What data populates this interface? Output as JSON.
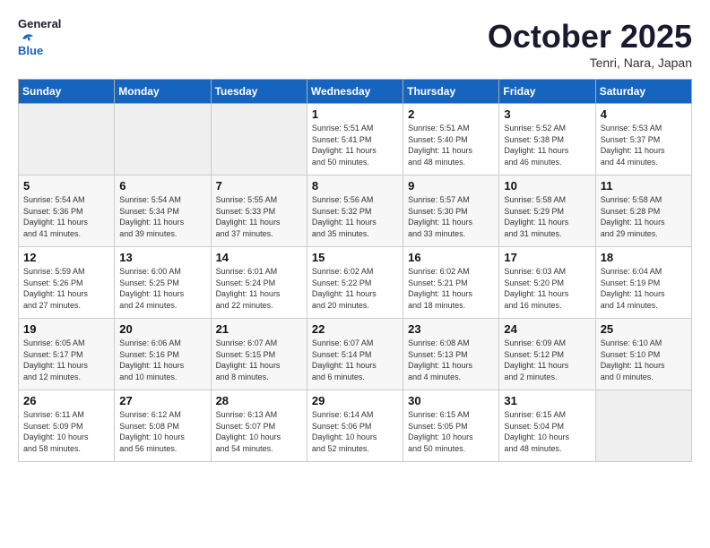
{
  "logo": {
    "line1": "General",
    "line2": "Blue"
  },
  "title": "October 2025",
  "location": "Tenri, Nara, Japan",
  "weekdays": [
    "Sunday",
    "Monday",
    "Tuesday",
    "Wednesday",
    "Thursday",
    "Friday",
    "Saturday"
  ],
  "weeks": [
    [
      {
        "day": "",
        "info": ""
      },
      {
        "day": "",
        "info": ""
      },
      {
        "day": "",
        "info": ""
      },
      {
        "day": "1",
        "info": "Sunrise: 5:51 AM\nSunset: 5:41 PM\nDaylight: 11 hours\nand 50 minutes."
      },
      {
        "day": "2",
        "info": "Sunrise: 5:51 AM\nSunset: 5:40 PM\nDaylight: 11 hours\nand 48 minutes."
      },
      {
        "day": "3",
        "info": "Sunrise: 5:52 AM\nSunset: 5:38 PM\nDaylight: 11 hours\nand 46 minutes."
      },
      {
        "day": "4",
        "info": "Sunrise: 5:53 AM\nSunset: 5:37 PM\nDaylight: 11 hours\nand 44 minutes."
      }
    ],
    [
      {
        "day": "5",
        "info": "Sunrise: 5:54 AM\nSunset: 5:36 PM\nDaylight: 11 hours\nand 41 minutes."
      },
      {
        "day": "6",
        "info": "Sunrise: 5:54 AM\nSunset: 5:34 PM\nDaylight: 11 hours\nand 39 minutes."
      },
      {
        "day": "7",
        "info": "Sunrise: 5:55 AM\nSunset: 5:33 PM\nDaylight: 11 hours\nand 37 minutes."
      },
      {
        "day": "8",
        "info": "Sunrise: 5:56 AM\nSunset: 5:32 PM\nDaylight: 11 hours\nand 35 minutes."
      },
      {
        "day": "9",
        "info": "Sunrise: 5:57 AM\nSunset: 5:30 PM\nDaylight: 11 hours\nand 33 minutes."
      },
      {
        "day": "10",
        "info": "Sunrise: 5:58 AM\nSunset: 5:29 PM\nDaylight: 11 hours\nand 31 minutes."
      },
      {
        "day": "11",
        "info": "Sunrise: 5:58 AM\nSunset: 5:28 PM\nDaylight: 11 hours\nand 29 minutes."
      }
    ],
    [
      {
        "day": "12",
        "info": "Sunrise: 5:59 AM\nSunset: 5:26 PM\nDaylight: 11 hours\nand 27 minutes."
      },
      {
        "day": "13",
        "info": "Sunrise: 6:00 AM\nSunset: 5:25 PM\nDaylight: 11 hours\nand 24 minutes."
      },
      {
        "day": "14",
        "info": "Sunrise: 6:01 AM\nSunset: 5:24 PM\nDaylight: 11 hours\nand 22 minutes."
      },
      {
        "day": "15",
        "info": "Sunrise: 6:02 AM\nSunset: 5:22 PM\nDaylight: 11 hours\nand 20 minutes."
      },
      {
        "day": "16",
        "info": "Sunrise: 6:02 AM\nSunset: 5:21 PM\nDaylight: 11 hours\nand 18 minutes."
      },
      {
        "day": "17",
        "info": "Sunrise: 6:03 AM\nSunset: 5:20 PM\nDaylight: 11 hours\nand 16 minutes."
      },
      {
        "day": "18",
        "info": "Sunrise: 6:04 AM\nSunset: 5:19 PM\nDaylight: 11 hours\nand 14 minutes."
      }
    ],
    [
      {
        "day": "19",
        "info": "Sunrise: 6:05 AM\nSunset: 5:17 PM\nDaylight: 11 hours\nand 12 minutes."
      },
      {
        "day": "20",
        "info": "Sunrise: 6:06 AM\nSunset: 5:16 PM\nDaylight: 11 hours\nand 10 minutes."
      },
      {
        "day": "21",
        "info": "Sunrise: 6:07 AM\nSunset: 5:15 PM\nDaylight: 11 hours\nand 8 minutes."
      },
      {
        "day": "22",
        "info": "Sunrise: 6:07 AM\nSunset: 5:14 PM\nDaylight: 11 hours\nand 6 minutes."
      },
      {
        "day": "23",
        "info": "Sunrise: 6:08 AM\nSunset: 5:13 PM\nDaylight: 11 hours\nand 4 minutes."
      },
      {
        "day": "24",
        "info": "Sunrise: 6:09 AM\nSunset: 5:12 PM\nDaylight: 11 hours\nand 2 minutes."
      },
      {
        "day": "25",
        "info": "Sunrise: 6:10 AM\nSunset: 5:10 PM\nDaylight: 11 hours\nand 0 minutes."
      }
    ],
    [
      {
        "day": "26",
        "info": "Sunrise: 6:11 AM\nSunset: 5:09 PM\nDaylight: 10 hours\nand 58 minutes."
      },
      {
        "day": "27",
        "info": "Sunrise: 6:12 AM\nSunset: 5:08 PM\nDaylight: 10 hours\nand 56 minutes."
      },
      {
        "day": "28",
        "info": "Sunrise: 6:13 AM\nSunset: 5:07 PM\nDaylight: 10 hours\nand 54 minutes."
      },
      {
        "day": "29",
        "info": "Sunrise: 6:14 AM\nSunset: 5:06 PM\nDaylight: 10 hours\nand 52 minutes."
      },
      {
        "day": "30",
        "info": "Sunrise: 6:15 AM\nSunset: 5:05 PM\nDaylight: 10 hours\nand 50 minutes."
      },
      {
        "day": "31",
        "info": "Sunrise: 6:15 AM\nSunset: 5:04 PM\nDaylight: 10 hours\nand 48 minutes."
      },
      {
        "day": "",
        "info": ""
      }
    ]
  ]
}
